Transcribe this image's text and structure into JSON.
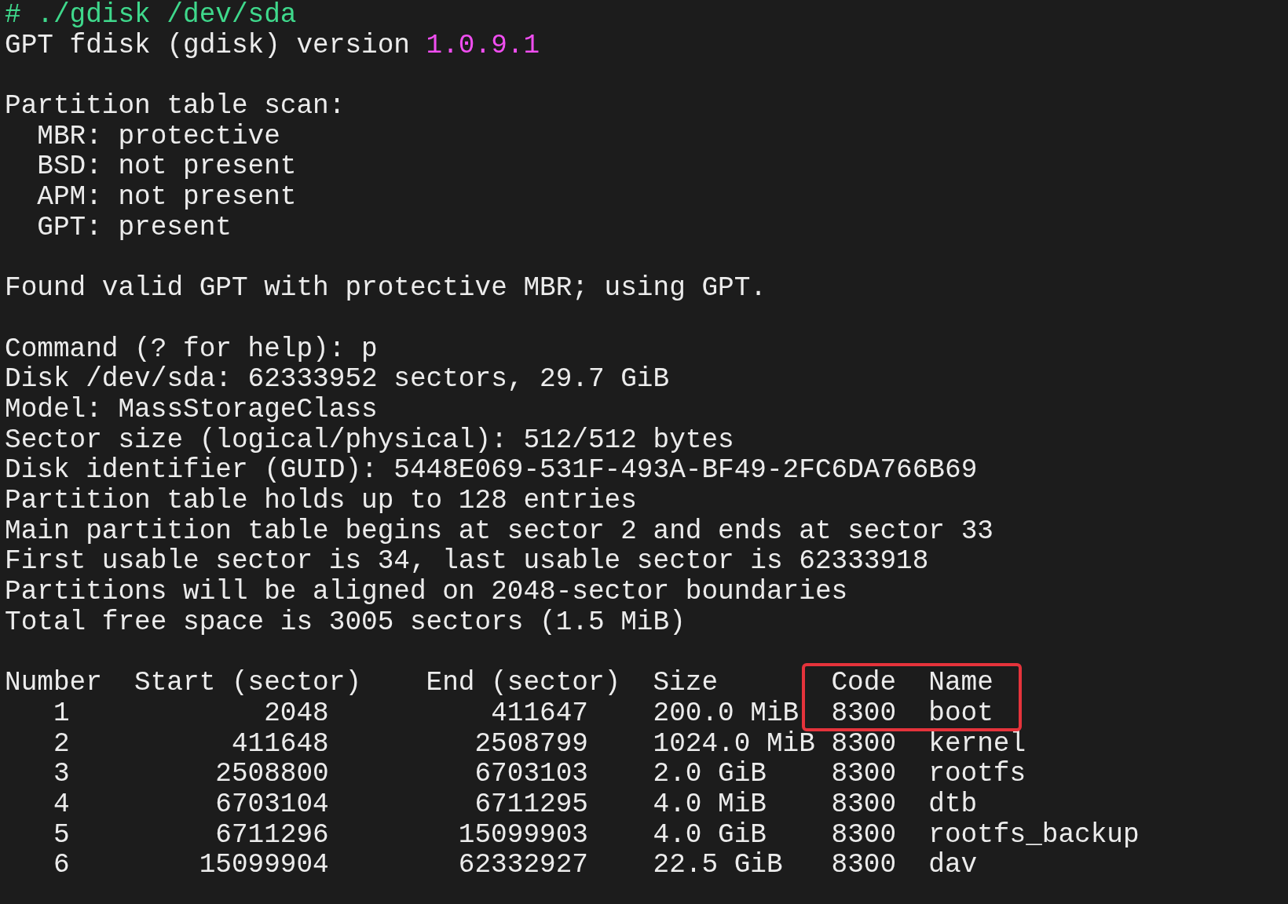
{
  "prompt": {
    "symbol": "#",
    "command": "./gdisk /dev/sda"
  },
  "version_line": {
    "text": "GPT fdisk (gdisk) version",
    "version": "1.0.9.1"
  },
  "scan": {
    "heading": "Partition table scan:",
    "items": [
      {
        "label": "MBR:",
        "value": "protective"
      },
      {
        "label": "BSD:",
        "value": "not present"
      },
      {
        "label": "APM:",
        "value": "not present"
      },
      {
        "label": "GPT:",
        "value": "present"
      }
    ]
  },
  "found": "Found valid GPT with protective MBR; using GPT.",
  "command_prompt": {
    "text": "Command (? for help):",
    "input": "p"
  },
  "disk_info": [
    "Disk /dev/sda: 62333952 sectors, 29.7 GiB",
    "Model: MassStorageClass",
    "Sector size (logical/physical): 512/512 bytes",
    "Disk identifier (GUID): 5448E069-531F-493A-BF49-2FC6DA766B69",
    "Partition table holds up to 128 entries",
    "Main partition table begins at sector 2 and ends at sector 33",
    "First usable sector is 34, last usable sector is 62333918",
    "Partitions will be aligned on 2048-sector boundaries",
    "Total free space is 3005 sectors (1.5 MiB)"
  ],
  "table": {
    "header_highlighted": true,
    "columns": [
      {
        "label": "Number",
        "highlighted": false
      },
      {
        "label": "Start (sector)",
        "highlighted": false
      },
      {
        "label": "End (sector)",
        "highlighted": false
      },
      {
        "label": "Size",
        "highlighted": false
      },
      {
        "label": "Code",
        "highlighted": true
      },
      {
        "label": "Name",
        "highlighted": true
      }
    ],
    "rows": [
      {
        "cells": [
          "1",
          "2048",
          "411647",
          "200.0 MiB",
          "8300",
          "boot"
        ],
        "highlighted": true
      },
      {
        "cells": [
          "2",
          "411648",
          "2508799",
          "1024.0 MiB",
          "8300",
          "kernel"
        ],
        "highlighted": false
      },
      {
        "cells": [
          "3",
          "2508800",
          "6703103",
          "2.0 GiB",
          "8300",
          "rootfs"
        ],
        "highlighted": false
      },
      {
        "cells": [
          "4",
          "6703104",
          "6711295",
          "4.0 MiB",
          "8300",
          "dtb"
        ],
        "highlighted": false
      },
      {
        "cells": [
          "5",
          "6711296",
          "15099903",
          "4.0 GiB",
          "8300",
          "rootfs_backup"
        ],
        "highlighted": false
      },
      {
        "cells": [
          "6",
          "15099904",
          "62332927",
          "22.5 GiB",
          "8300",
          "dav"
        ],
        "highlighted": false
      }
    ]
  }
}
